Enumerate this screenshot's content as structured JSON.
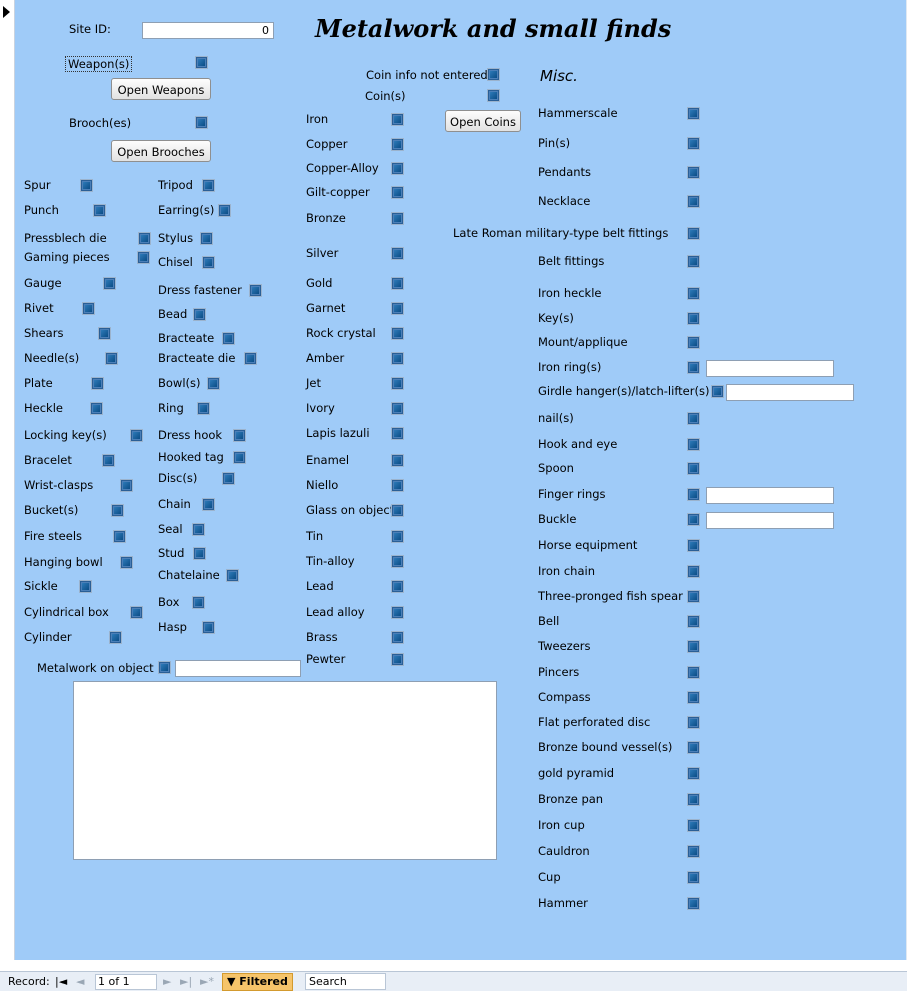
{
  "form": {
    "title": "Metalwork and small finds",
    "misc_heading": "Misc.",
    "site_id_label": "Site ID:",
    "site_id_value": "0",
    "weapons_label": "Weapon(s)",
    "open_weapons": "Open Weapons",
    "brooches_label": "Brooch(es)",
    "open_brooches": "Open Brooches",
    "coin_info_label": "Coin info not entered",
    "coins_label": "Coin(s)",
    "open_coins": "Open Coins",
    "metalwork_on_object_label": "Metalwork on object",
    "metalwork_on_object_value": "",
    "notes_value": ""
  },
  "col1": [
    "Spur",
    "Punch",
    "Pressblech die",
    "Gaming pieces",
    "Gauge",
    "Rivet",
    "Shears",
    "Needle(s)",
    "Plate",
    "Heckle",
    "Locking key(s)",
    "Bracelet",
    "Wrist-clasps",
    "Bucket(s)",
    "Fire steels",
    "Hanging bowl",
    "Sickle",
    "Cylindrical box",
    "Cylinder"
  ],
  "col2": [
    "Tripod",
    "Earring(s)",
    "Stylus",
    "Chisel",
    "Dress fastener",
    "Bead",
    "Bracteate",
    "Bracteate die",
    "Bowl(s)",
    "Ring",
    "Dress hook",
    "Hooked tag",
    "Disc(s)",
    "Chain",
    "Seal",
    "Stud",
    "Chatelaine",
    "Box",
    "Hasp"
  ],
  "col3": [
    "Iron",
    "Copper",
    "Copper-Alloy",
    "Gilt-copper",
    "Bronze",
    "Silver",
    "Gold",
    "Garnet",
    "Rock crystal",
    "Amber",
    "Jet",
    "Ivory",
    "Lapis lazuli",
    "Enamel",
    "Niello",
    "Glass on object",
    "Tin",
    "Tin-alloy",
    "Lead",
    "Lead alloy",
    "Brass",
    "Pewter"
  ],
  "col4": [
    "Hammerscale",
    "Pin(s)",
    "Pendants",
    "Necklace",
    "Late Roman military-type belt fittings",
    "Belt fittings",
    "Iron heckle",
    "Key(s)",
    "Mount/applique",
    "Iron ring(s)",
    "Girdle hanger(s)/latch-lifter(s)",
    "nail(s)",
    "Hook and eye",
    "Spoon",
    "Finger rings",
    "Buckle",
    "Horse equipment",
    "Iron chain",
    "Three-pronged fish spear",
    "Bell",
    "Tweezers",
    "Pincers",
    "Compass",
    "Flat perforated disc",
    "Bronze bound vessel(s)",
    "gold pyramid",
    "Bronze pan",
    "Iron cup",
    "Cauldron",
    "Cup",
    "Hammer"
  ],
  "navbar": {
    "record_label": "Record:",
    "first": "|◄",
    "prev": "◄",
    "current": "1 of 1",
    "next": "►",
    "last": "►|",
    "new": "►*",
    "filtered": "Filtered",
    "search": "Search"
  },
  "colors": {
    "form_background": "#9fcbf8",
    "checkbox": "#1f6aa8",
    "filter_badge": "#f6c46a"
  }
}
